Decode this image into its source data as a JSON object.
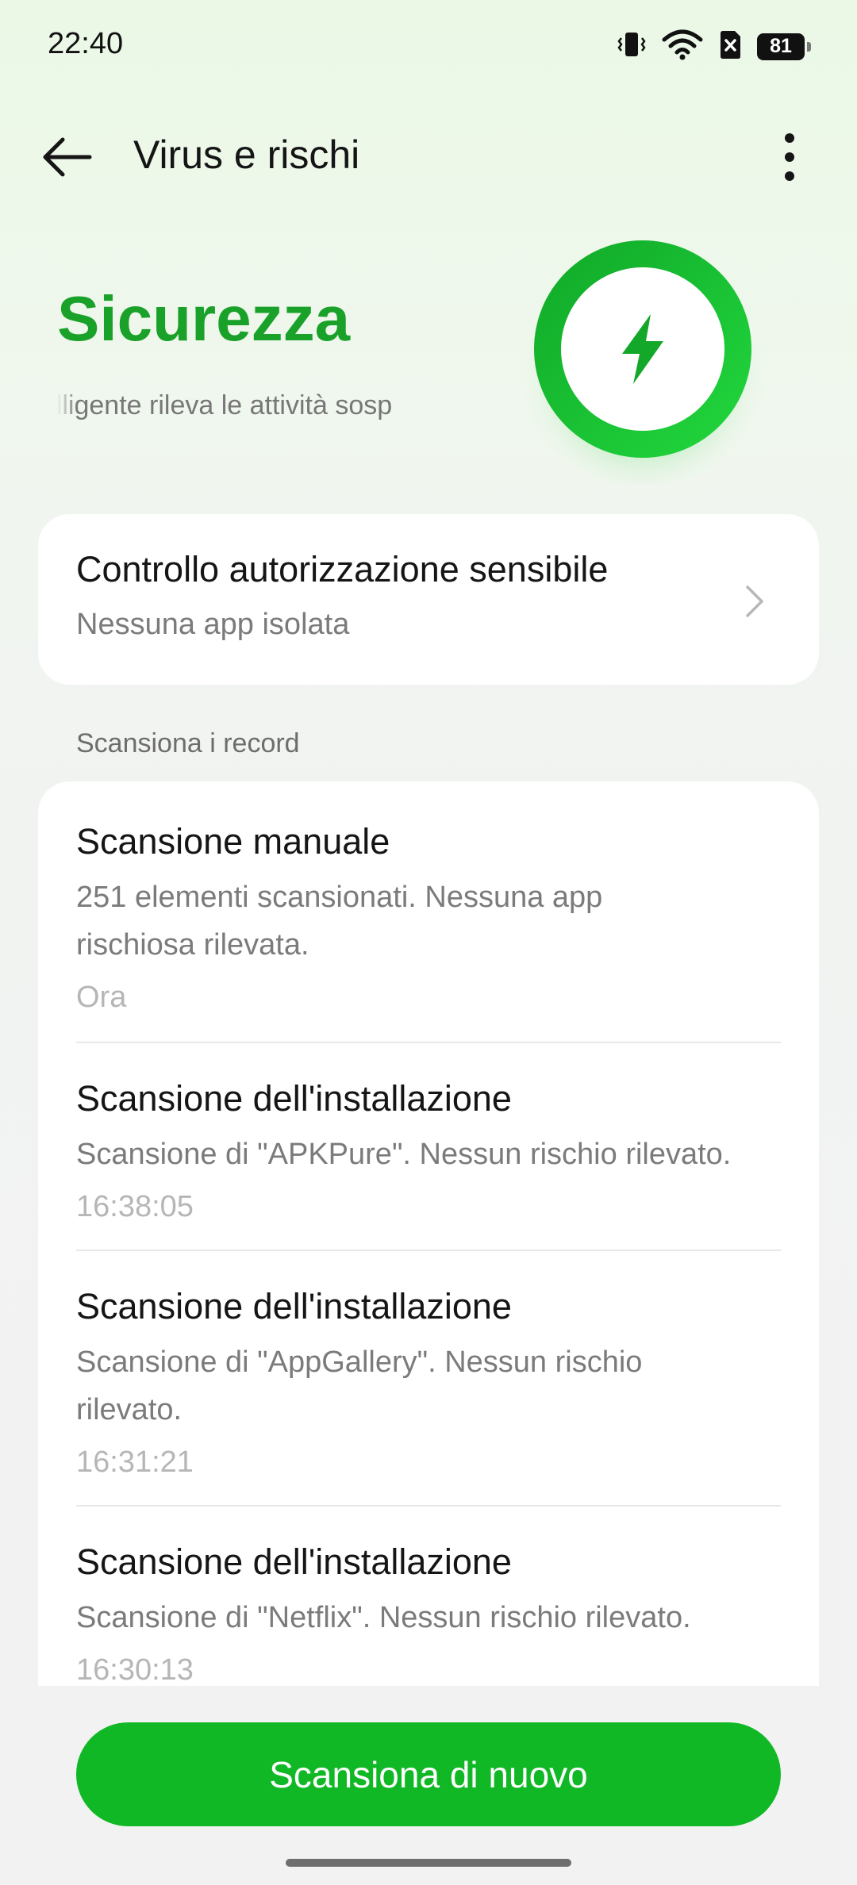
{
  "status_bar": {
    "time": "22:40",
    "battery": "81",
    "icons": [
      "vibrate-icon",
      "wifi-icon",
      "sim-off-icon",
      "battery-icon"
    ]
  },
  "toolbar": {
    "title": "Virus e rischi",
    "back_icon": "back-arrow-icon",
    "more_icon": "more-vertical-icon"
  },
  "hero": {
    "title": "Sicurezza",
    "subtitle": "intelligente rileva le attività sosp",
    "icon": "lightning-icon"
  },
  "sensitive_card": {
    "title": "Controllo autorizzazione sensibile",
    "subtitle": "Nessuna app isolata"
  },
  "records": {
    "section_label": "Scansiona i record",
    "items": [
      {
        "title": "Scansione manuale",
        "desc_line1": "251 elementi scansionati. Nessuna app",
        "desc_line2": "rischiosa rilevata.",
        "time": "Ora"
      },
      {
        "title": "Scansione dell'installazione",
        "desc_line1": "Scansione di \"APKPure\". Nessun rischio rilevato.",
        "time": "16:38:05"
      },
      {
        "title": "Scansione dell'installazione",
        "desc_line1": "Scansione di \"AppGallery\". Nessun rischio",
        "desc_line2": "rilevato.",
        "time": "16:31:21"
      },
      {
        "title": "Scansione dell'installazione",
        "desc_line1": "Scansione di \"Netflix\". Nessun rischio rilevato.",
        "time": "16:30:13"
      }
    ]
  },
  "actions": {
    "rescan_label": "Scansiona di nuovo"
  },
  "colors": {
    "accent": "#11b825",
    "title_green": "#1aa12a"
  }
}
